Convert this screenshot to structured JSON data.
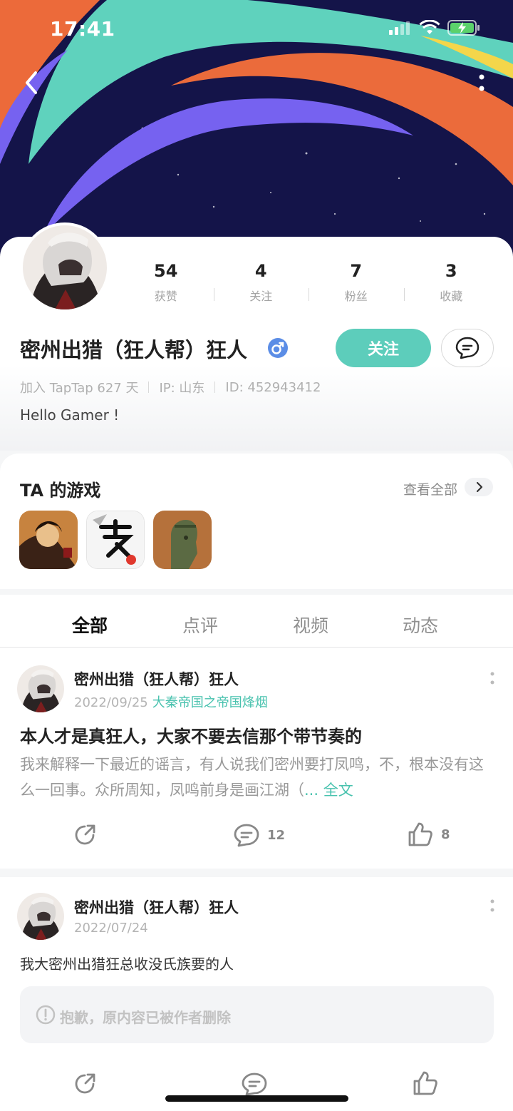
{
  "status_bar": {
    "time": "17:41"
  },
  "profile": {
    "name": "密州出猎（狂人帮）狂人",
    "stats": [
      {
        "value": "54",
        "label": "获赞"
      },
      {
        "value": "4",
        "label": "关注"
      },
      {
        "value": "7",
        "label": "粉丝"
      },
      {
        "value": "3",
        "label": "收藏"
      }
    ],
    "follow_label": "关注",
    "meta": {
      "join": "加入 TapTap 627 天",
      "ip": "IP: 山东",
      "id": "ID: 452943412"
    },
    "bio": "Hello Gamer !"
  },
  "games": {
    "title": "TA 的游戏",
    "view_all": "查看全部"
  },
  "tabs": [
    "全部",
    "点评",
    "视频",
    "动态"
  ],
  "posts": [
    {
      "author": "密州出猎（狂人帮）狂人",
      "date": "2022/09/25",
      "tag": "大秦帝国之帝国烽烟",
      "title": "本人才是真狂人，大家不要去信那个带节奏的",
      "body": "我来解释一下最近的谣言，有人说我们密州要打凤鸣，不，根本没有这么一回事。众所周知，凤鸣前身是画江湖（",
      "more": "... 全文",
      "comments": "12",
      "likes": "8"
    },
    {
      "author": "密州出猎（狂人帮）狂人",
      "date": "2022/07/24",
      "text": "我大密州出猎狂总收没氏族要的人",
      "deleted_notice": "抱歉，原内容已被作者删除"
    }
  ]
}
